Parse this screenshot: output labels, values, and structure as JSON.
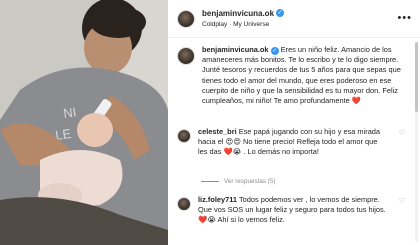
{
  "post": {
    "username": "benjaminvicuna.ok",
    "song": "Coldplay · My Universe"
  },
  "caption": {
    "username": "benjaminvicuna.ok",
    "text": "Eres un niño feliz. Amancio de los amaneceres más bonitos. Te lo escribo y te lo digo siempre. Junté tesoros y recuerdos de tus 5 años para que sepas que tienes todo el amor del mundo, que eres poderoso en ese cuerpito de niño y que la sensibilidad es tu mayor don. Feliz cumpleaños, mi niño! Te amo profundamente",
    "emoji": "❤️"
  },
  "comments": [
    {
      "username": "celeste_bri",
      "text": "Ese papá jugando con su hijo y esa mirada hacia el 😍😍 No tiene precio! Refleja todo el amor que les das ❤️😭 . Lo demás no importa!",
      "replies_label": "Ver respuestas (5)"
    },
    {
      "username": "liz.foley711",
      "text": "Todos podemos ver , lo vemos de siempre. Que vos SOS un lugar feliz y seguro para todos tus hijos. ❤️😭 Ahí si lo vemos feliz."
    }
  ],
  "icons": {
    "more": "more-dots-icon",
    "verified": "verified-badge-icon",
    "like": "heart-icon"
  },
  "colors": {
    "verified": "#3897f0",
    "heart": "#ed4956"
  }
}
